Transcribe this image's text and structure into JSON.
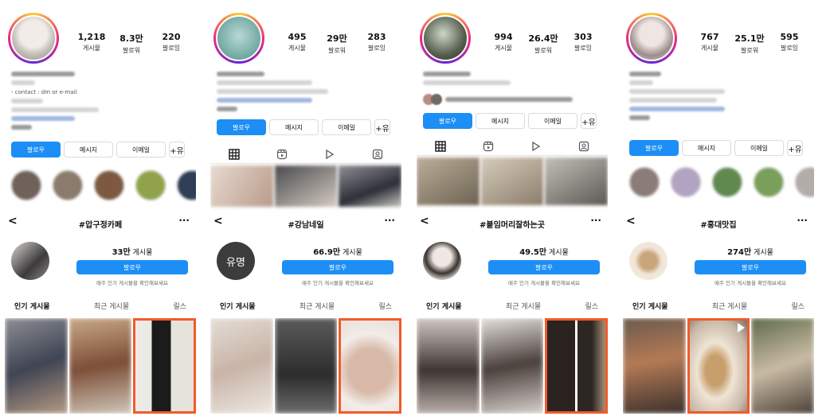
{
  "panels": [
    {
      "stats": [
        {
          "num": "1,218",
          "label": "게시물"
        },
        {
          "num": "8.3만",
          "label": "팔로워"
        },
        {
          "num": "220",
          "label": "팔로잉"
        }
      ],
      "bio_visible": "- contact : dm or e-mail",
      "buttons": [
        "팔로우",
        "메시지",
        "이메일",
        "+유"
      ],
      "hashtag": "#압구정카페",
      "tag_count_num": "33만",
      "tag_count_unit": "게시물",
      "tag_follow": "팔로우",
      "tag_note": "매주 인기 게시물을 확인해보세요",
      "tabs": [
        "인기 게시물",
        "최근 게시물",
        "릴스"
      ],
      "nav": {
        "back": "<",
        "more": "···"
      }
    },
    {
      "stats": [
        {
          "num": "495",
          "label": "게시물"
        },
        {
          "num": "29만",
          "label": "팔로워"
        },
        {
          "num": "283",
          "label": "팔로잉"
        }
      ],
      "bio_visible": "",
      "buttons": [
        "팔로우",
        "메시지",
        "이메일",
        "+유"
      ],
      "hashtag": "#강남네일",
      "tag_count_num": "66.9만",
      "tag_count_unit": "게시물",
      "tag_follow": "팔로우",
      "tag_note": "매주 인기 게시물을 확인해보세요",
      "tabs": [
        "인기 게시물",
        "최근 게시물",
        "릴스"
      ],
      "nav": {
        "back": "<",
        "more": "···"
      },
      "logo_text": "유명"
    },
    {
      "stats": [
        {
          "num": "994",
          "label": "게시물"
        },
        {
          "num": "26.4만",
          "label": "팔로워"
        },
        {
          "num": "303",
          "label": "팔로잉"
        }
      ],
      "bio_visible": "",
      "buttons": [
        "팔로우",
        "메시지",
        "이메일",
        "+유"
      ],
      "hashtag": "#붙임머리잘하는곳",
      "tag_count_num": "49.5만",
      "tag_count_unit": "게시물",
      "tag_follow": "팔로우",
      "tag_note": "매주 인기 게시물을 확인해보세요",
      "tabs": [
        "인기 게시물",
        "최근 게시물",
        "릴스"
      ],
      "nav": {
        "back": "<",
        "more": "···"
      }
    },
    {
      "stats": [
        {
          "num": "767",
          "label": "게시물"
        },
        {
          "num": "25.1만",
          "label": "팔로워"
        },
        {
          "num": "595",
          "label": "팔로잉"
        }
      ],
      "bio_visible": "",
      "buttons": [
        "팔로우",
        "메시지",
        "이메일",
        "+유"
      ],
      "hashtag": "#홍대맛집",
      "tag_count_num": "274만",
      "tag_count_unit": "게시물",
      "tag_follow": "팔로우",
      "tag_note": "매주 인기 게시물을 확인해보세요",
      "tabs": [
        "인기 게시물",
        "최근 게시물",
        "릴스"
      ],
      "nav": {
        "back": "<",
        "more": "···"
      }
    }
  ],
  "colors": {
    "accent": "#1c8ef5",
    "highlight_box": "#f15a2a"
  }
}
